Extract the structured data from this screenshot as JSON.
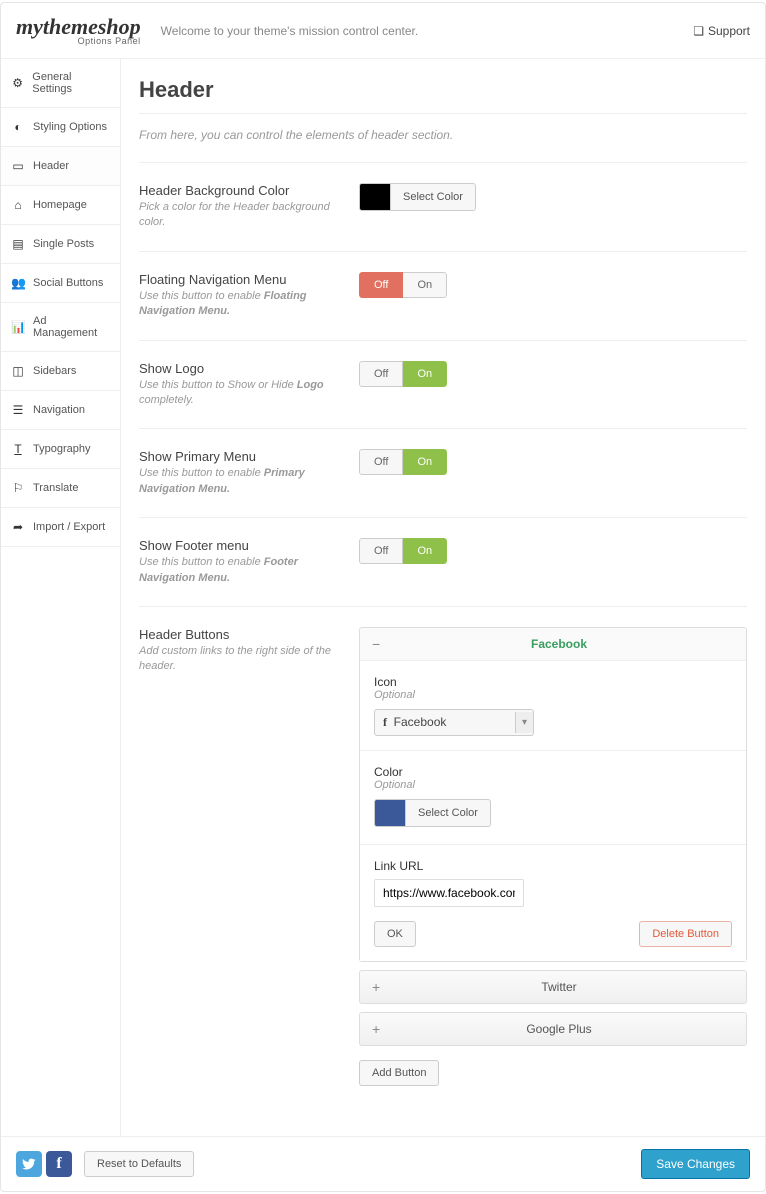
{
  "brand": {
    "name": "mythemeshop",
    "subtitle": "Options Panel"
  },
  "welcome": "Welcome to your theme's mission control center.",
  "support": "Support",
  "sidebar": {
    "items": [
      {
        "label": "General Settings"
      },
      {
        "label": "Styling Options"
      },
      {
        "label": "Header"
      },
      {
        "label": "Homepage"
      },
      {
        "label": "Single Posts"
      },
      {
        "label": "Social Buttons"
      },
      {
        "label": "Ad Management"
      },
      {
        "label": "Sidebars"
      },
      {
        "label": "Navigation"
      },
      {
        "label": "Typography"
      },
      {
        "label": "Translate"
      },
      {
        "label": "Import / Export"
      }
    ]
  },
  "page": {
    "title": "Header",
    "description": "From here, you can control the elements of header section."
  },
  "fields": {
    "bg_color": {
      "label": "Header Background Color",
      "hint": "Pick a color for the Header background color.",
      "select_label": "Select Color",
      "value": "#000000"
    },
    "floating_nav": {
      "label": "Floating Navigation Menu",
      "hint_pre": "Use this button to enable ",
      "hint_bold": "Floating Navigation Menu.",
      "off": "Off",
      "on": "On",
      "value": "off"
    },
    "show_logo": {
      "label": "Show Logo",
      "hint_pre": "Use this button to Show or Hide ",
      "hint_bold": "Logo",
      "hint_post": " completely.",
      "off": "Off",
      "on": "On",
      "value": "on"
    },
    "primary_menu": {
      "label": "Show Primary Menu",
      "hint_pre": "Use this button to enable ",
      "hint_bold": "Primary Navigation Menu.",
      "off": "Off",
      "on": "On",
      "value": "on"
    },
    "footer_menu": {
      "label": "Show Footer menu",
      "hint_pre": "Use this button to enable ",
      "hint_bold": "Footer Navigation Menu.",
      "off": "Off",
      "on": "On",
      "value": "on"
    },
    "header_buttons": {
      "label": "Header Buttons",
      "hint": "Add custom links to the right side of the header.",
      "items": [
        {
          "title": "Facebook",
          "expanded": true,
          "icon_label": "Icon",
          "icon_hint": "Optional",
          "icon_value": "Facebook",
          "color_label": "Color",
          "color_hint": "Optional",
          "color_select_label": "Select Color",
          "color_value": "#3b5998",
          "url_label": "Link URL",
          "url_value": "https://www.facebook.com",
          "ok_label": "OK",
          "delete_label": "Delete Button"
        },
        {
          "title": "Twitter",
          "expanded": false
        },
        {
          "title": "Google Plus",
          "expanded": false
        }
      ],
      "add_label": "Add Button"
    }
  },
  "footer": {
    "reset": "Reset to Defaults",
    "save": "Save Changes"
  }
}
